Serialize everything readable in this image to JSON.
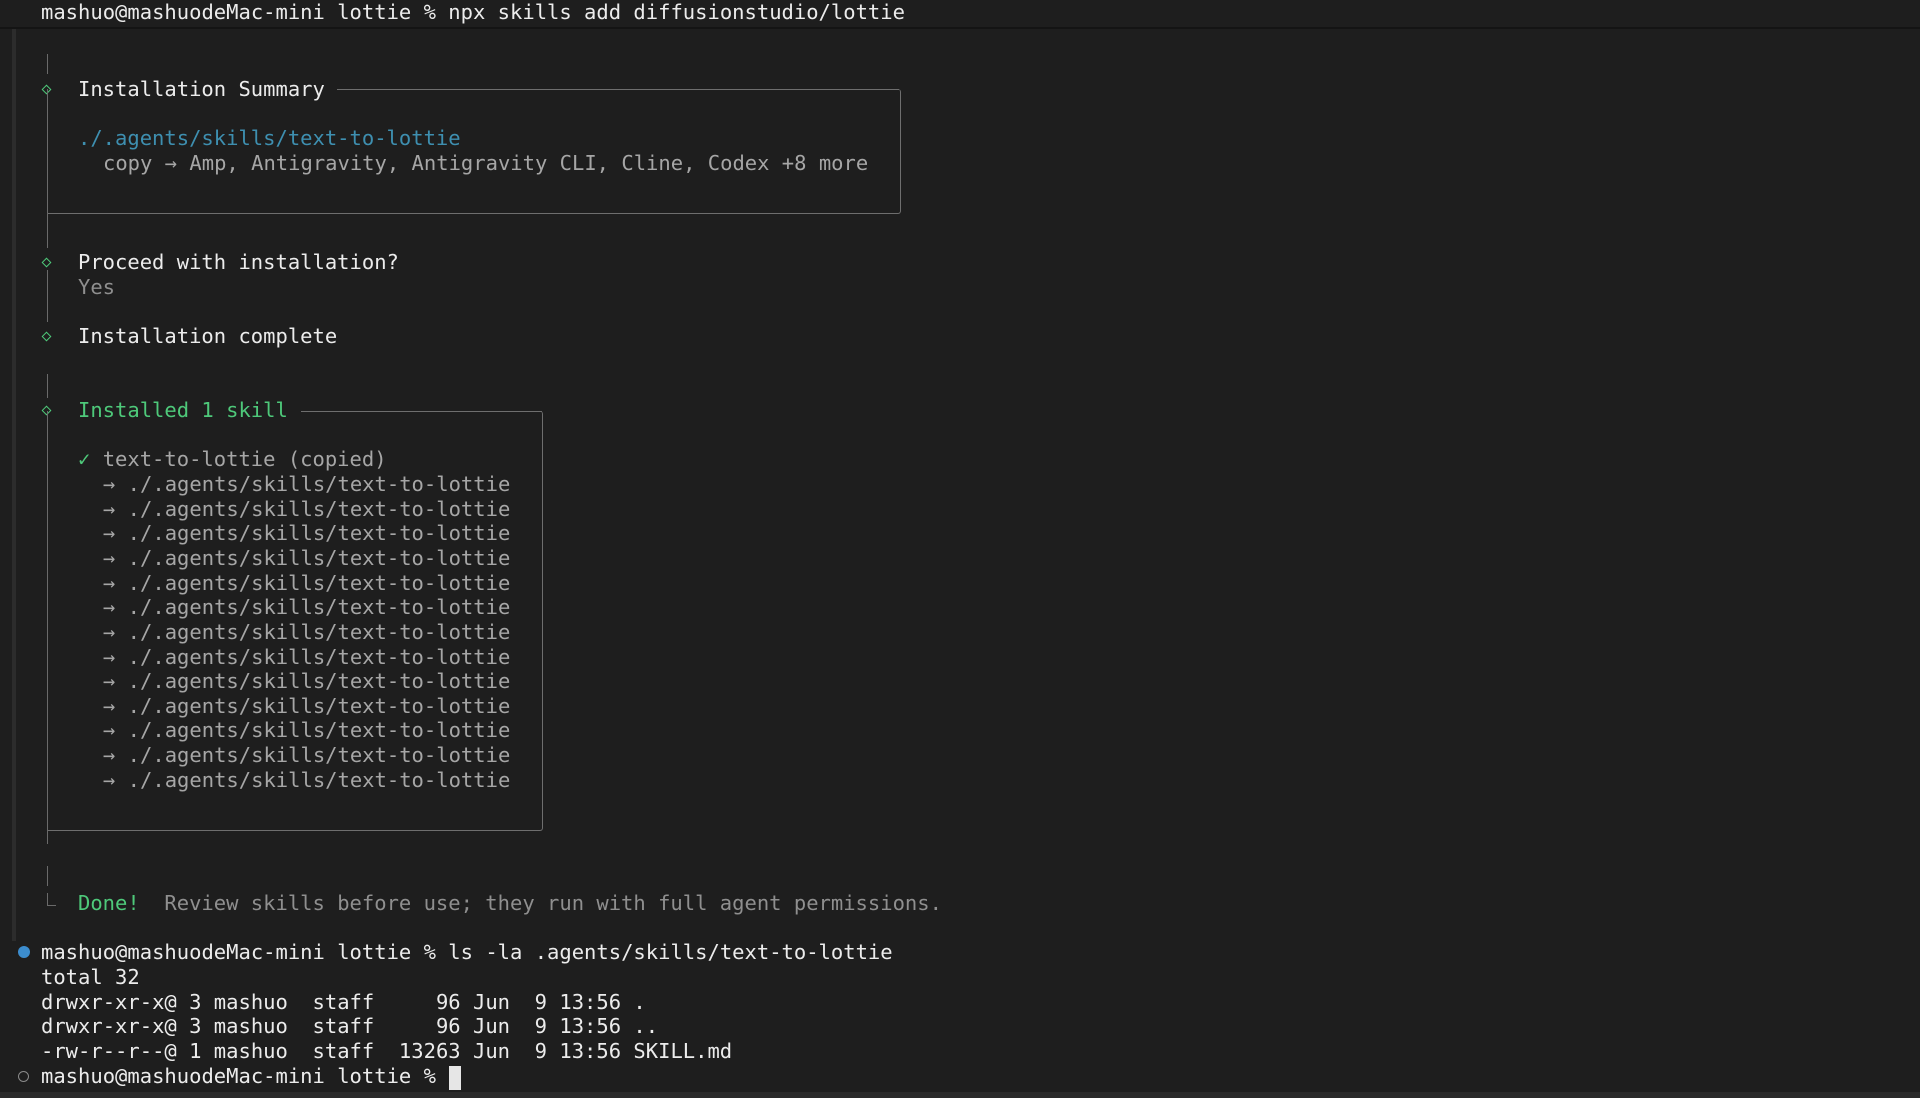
{
  "terminal": {
    "command1": {
      "prompt": "mashuo@mashuodeMac-mini lottie % ",
      "command": "npx skills add diffusionstudio/lottie"
    },
    "summary": {
      "title": "Installation Summary",
      "path": "./.agents/skills/text-to-lottie",
      "copy_line": "copy → Amp, Antigravity, Antigravity CLI, Cline, Codex +8 more"
    },
    "proceed": {
      "question": "Proceed with installation?",
      "answer": "Yes"
    },
    "complete": {
      "label": "Installation complete"
    },
    "installed": {
      "title": "Installed 1 skill",
      "check": "✓",
      "skill": "text-to-lottie (copied)",
      "targets": [
        "→ ./.agents/skills/text-to-lottie",
        "→ ./.agents/skills/text-to-lottie",
        "→ ./.agents/skills/text-to-lottie",
        "→ ./.agents/skills/text-to-lottie",
        "→ ./.agents/skills/text-to-lottie",
        "→ ./.agents/skills/text-to-lottie",
        "→ ./.agents/skills/text-to-lottie",
        "→ ./.agents/skills/text-to-lottie",
        "→ ./.agents/skills/text-to-lottie",
        "→ ./.agents/skills/text-to-lottie",
        "→ ./.agents/skills/text-to-lottie",
        "→ ./.agents/skills/text-to-lottie",
        "→ ./.agents/skills/text-to-lottie"
      ]
    },
    "done": {
      "label": "Done!",
      "message": "Review skills before use; they run with full agent permissions."
    },
    "command2": {
      "prompt": "mashuo@mashuodeMac-mini lottie % ",
      "command": "ls -la .agents/skills/text-to-lottie"
    },
    "ls_output": [
      "total 32",
      "drwxr-xr-x@ 3 mashuo  staff     96 Jun  9 13:56 .",
      "drwxr-xr-x@ 3 mashuo  staff     96 Jun  9 13:56 ..",
      "-rw-r--r--@ 1 mashuo  staff  13263 Jun  9 13:56 SKILL.md"
    ],
    "command3": {
      "prompt": "mashuo@mashuodeMac-mini lottie % "
    },
    "colors": {
      "background": "#1e1e1e",
      "accent_green": "#4ec97a",
      "path_cyan": "#3e8fb0",
      "status_dot_blue": "#3c8dce"
    },
    "icons": {
      "step_marker": "diamond-icon",
      "success_marker": "check-icon",
      "command_success": "filled-circle-icon",
      "command_pending": "hollow-circle-icon"
    }
  }
}
